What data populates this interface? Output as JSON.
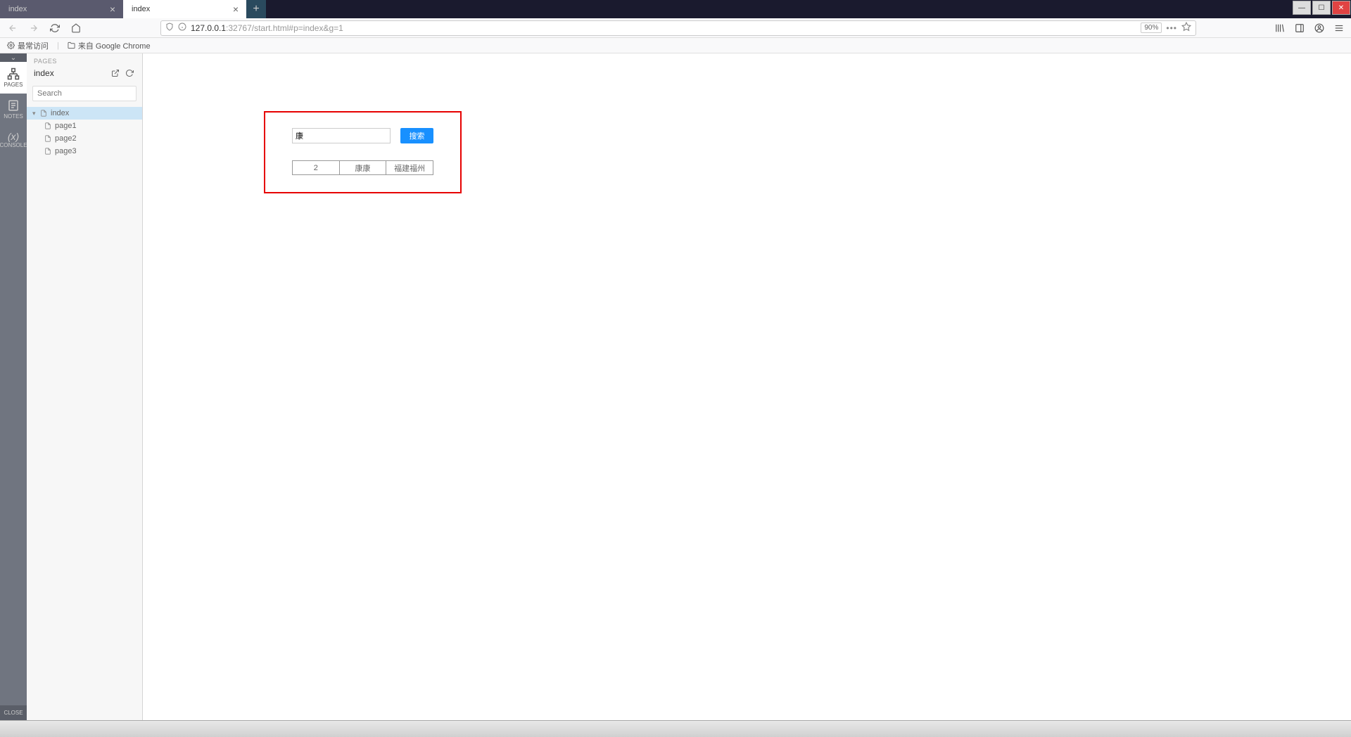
{
  "tabs": [
    {
      "title": "index",
      "active": false
    },
    {
      "title": "index",
      "active": true
    }
  ],
  "url": {
    "prefix": "127.0.0.1",
    "rest": ":32767/start.html#p=index&g=1"
  },
  "zoom": "90%",
  "bookmarks": {
    "most_visited": "最常访问",
    "from_chrome": "来自 Google Chrome"
  },
  "rail": {
    "pages": "PAGES",
    "notes": "NOTES",
    "console": "CONSOLE",
    "close": "CLOSE"
  },
  "panel": {
    "header": "PAGES",
    "title": "index",
    "search_placeholder": "Search",
    "tree": {
      "root": "index",
      "children": [
        "page1",
        "page2",
        "page3"
      ]
    }
  },
  "demo": {
    "input_value": "康",
    "button": "搜索",
    "row": {
      "c0": "2",
      "c1": "康康",
      "c2": "福建福州"
    }
  }
}
